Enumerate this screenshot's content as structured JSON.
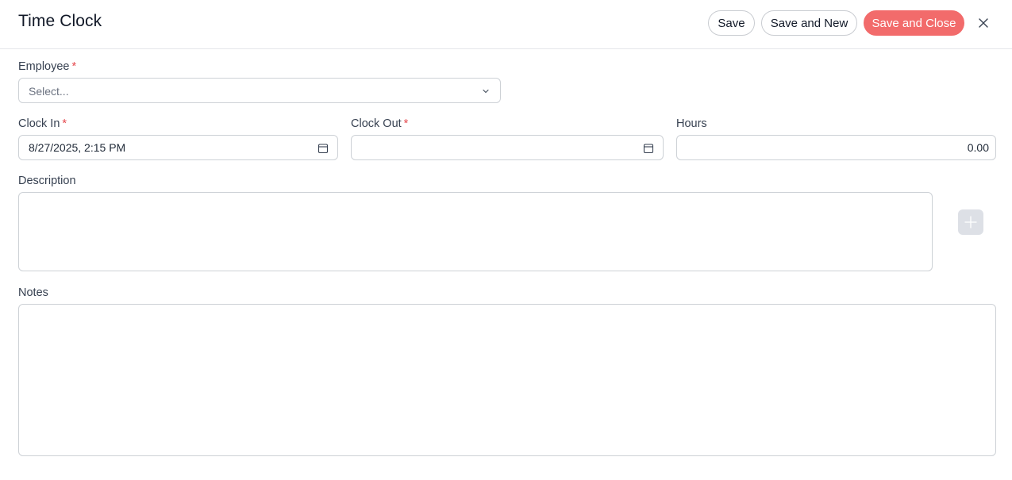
{
  "header": {
    "title": "Time Clock",
    "save_label": "Save",
    "save_new_label": "Save and New",
    "save_close_label": "Save and Close",
    "close_icon": "close-icon"
  },
  "form": {
    "employee": {
      "label": "Employee",
      "required_mark": "*",
      "placeholder": "Select...",
      "icon": "chevron-down-icon"
    },
    "clock_in": {
      "label": "Clock In",
      "required_mark": "*",
      "value": "8/27/2025, 2:15 PM",
      "icon": "calendar-icon"
    },
    "clock_out": {
      "label": "Clock Out",
      "required_mark": "*",
      "value": "",
      "icon": "calendar-icon"
    },
    "hours": {
      "label": "Hours",
      "value": "0.00"
    },
    "description": {
      "label": "Description",
      "value": ""
    },
    "notes": {
      "label": "Notes",
      "value": ""
    },
    "add_button_icon": "plus-icon"
  },
  "colors": {
    "accent": "#f26b6b",
    "required": "#e5484d",
    "border": "#cdd1d6",
    "add_button_bg": "#dde0e6"
  }
}
